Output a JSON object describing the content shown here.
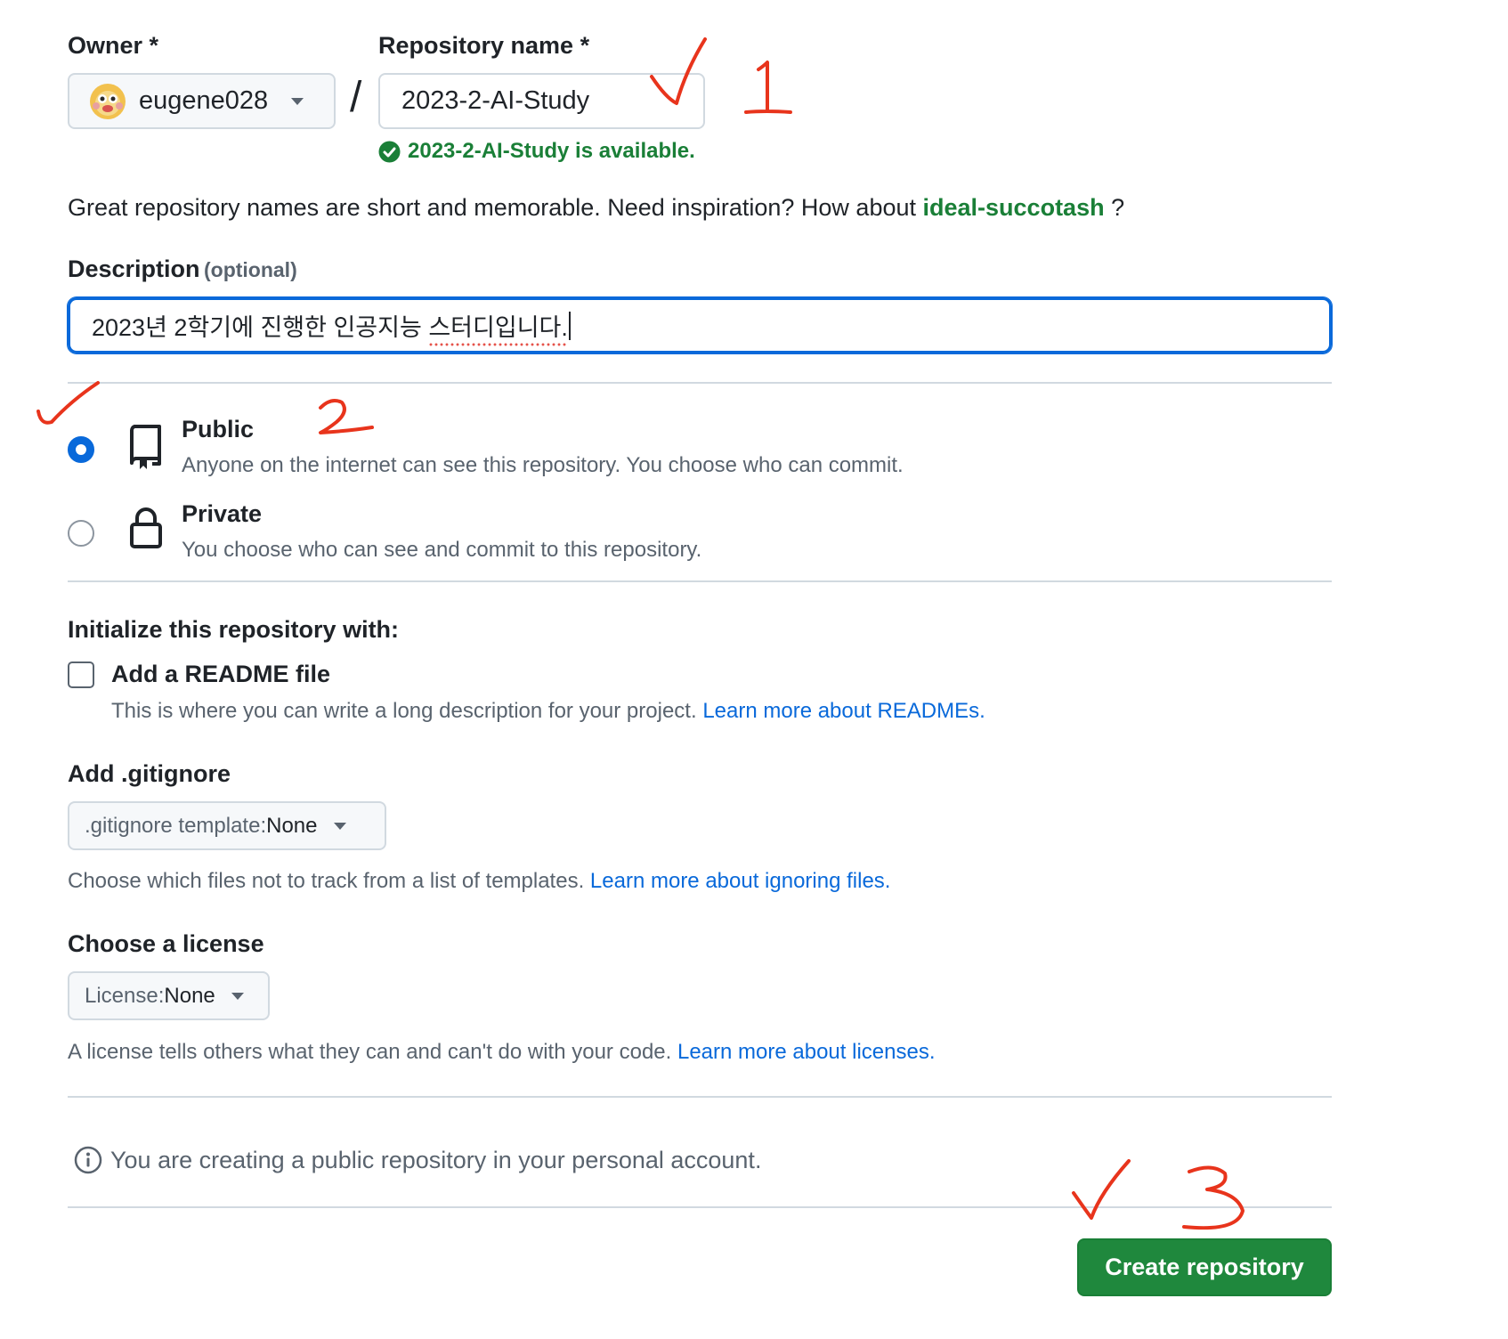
{
  "owner": {
    "label": "Owner",
    "required_mark": "*",
    "value": "eugene028"
  },
  "slash": "/",
  "repo_name": {
    "label": "Repository name",
    "required_mark": "*",
    "value": "2023-2-AI-Study",
    "availability": "2023-2-AI-Study is available."
  },
  "suggestion": {
    "text": "Great repository names are short and memorable. Need inspiration? How about",
    "name": "ideal-succotash",
    "end": "?"
  },
  "description": {
    "label": "Description",
    "optional": "(optional)",
    "value_main": "2023년 2학기에 진행한 인공지능 ",
    "value_flagged": "스터디입니다."
  },
  "visibility": {
    "public": {
      "title": "Public",
      "desc": "Anyone on the internet can see this repository. You choose who can commit.",
      "selected": true
    },
    "private": {
      "title": "Private",
      "desc": "You choose who can see and commit to this repository.",
      "selected": false
    }
  },
  "init": {
    "heading": "Initialize this repository with:",
    "readme_label": "Add a README file",
    "readme_desc": "This is where you can write a long description for your project.",
    "readme_link": "Learn more about READMEs.",
    "readme_checked": false
  },
  "gitignore": {
    "heading": "Add .gitignore",
    "select_prefix": ".gitignore template:",
    "select_value": "None",
    "desc": "Choose which files not to track from a list of templates.",
    "link": "Learn more about ignoring files."
  },
  "license": {
    "heading": "Choose a license",
    "select_prefix": "License:",
    "select_value": "None",
    "desc": "A license tells others what they can and can't do with your code.",
    "link": "Learn more about licenses."
  },
  "notice": {
    "text": "You are creating a public repository in your personal account."
  },
  "create_button": "Create repository",
  "annotations": {
    "step1": "1",
    "step2": "2",
    "step3": "3"
  },
  "colors": {
    "accent_blue": "#0969da",
    "success_green": "#1a7f37",
    "button_green": "#1f883d",
    "annotation_red": "#e8341c"
  },
  "icons": {
    "owner_avatar": "avatar-icon",
    "available": "check-circle-icon",
    "public": "repo-icon",
    "private": "lock-icon",
    "notice": "info-icon"
  }
}
